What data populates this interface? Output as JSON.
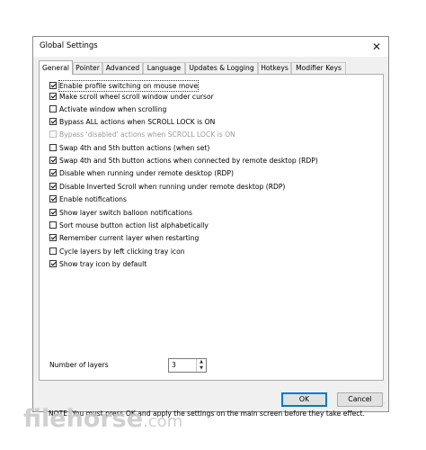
{
  "window": {
    "title": "Global Settings",
    "close_glyph": "✕"
  },
  "tabs": [
    {
      "label": "General",
      "active": true
    },
    {
      "label": "Pointer"
    },
    {
      "label": "Advanced"
    },
    {
      "label": "Language"
    },
    {
      "label": "Updates & Logging"
    },
    {
      "label": "Hotkeys"
    },
    {
      "label": "Modifier Keys"
    }
  ],
  "options": [
    {
      "label": "Enable profile switching on mouse move",
      "checked": true
    },
    {
      "label": "Make scroll wheel scroll window under cursor",
      "checked": true
    },
    {
      "label": "Activate window when scrolling",
      "checked": false
    },
    {
      "label": "Bypass ALL actions when SCROLL LOCK is ON",
      "checked": true
    },
    {
      "label": "Bypass 'disabled' actions when SCROLL LOCK is ON",
      "checked": false,
      "disabled": true
    },
    {
      "label": "Swap 4th and 5th button actions (when set)",
      "checked": false
    },
    {
      "label": "Swap 4th and 5th button actions when connected by remote desktop (RDP)",
      "checked": true
    },
    {
      "label": "Disable when running under remote desktop (RDP)",
      "checked": true
    },
    {
      "label": "Disable Inverted Scroll when running under remote desktop (RDP)",
      "checked": true
    },
    {
      "label": "Enable notifications",
      "checked": true
    },
    {
      "label": "Show layer switch balloon notifications",
      "checked": true
    },
    {
      "label": "Sort mouse button action list alphabetically",
      "checked": false
    },
    {
      "label": "Remember current layer when restarting",
      "checked": true
    },
    {
      "label": "Cycle layers by left clicking tray icon",
      "checked": false
    },
    {
      "label": "Show tray icon by default",
      "checked": true
    }
  ],
  "layers": {
    "label": "Number of layers",
    "value": "3",
    "up_glyph": "▲",
    "down_glyph": "▼"
  },
  "note": "NOTE: You must press OK and apply the settings on the main screen before they take effect.",
  "buttons": {
    "ok": "OK",
    "cancel": "Cancel"
  },
  "watermark": {
    "brand": "filehorse",
    "suffix": ".com"
  },
  "colors": {
    "accent": "#0078d7",
    "panel": "#ffffff",
    "chrome": "#f0f0f0"
  }
}
